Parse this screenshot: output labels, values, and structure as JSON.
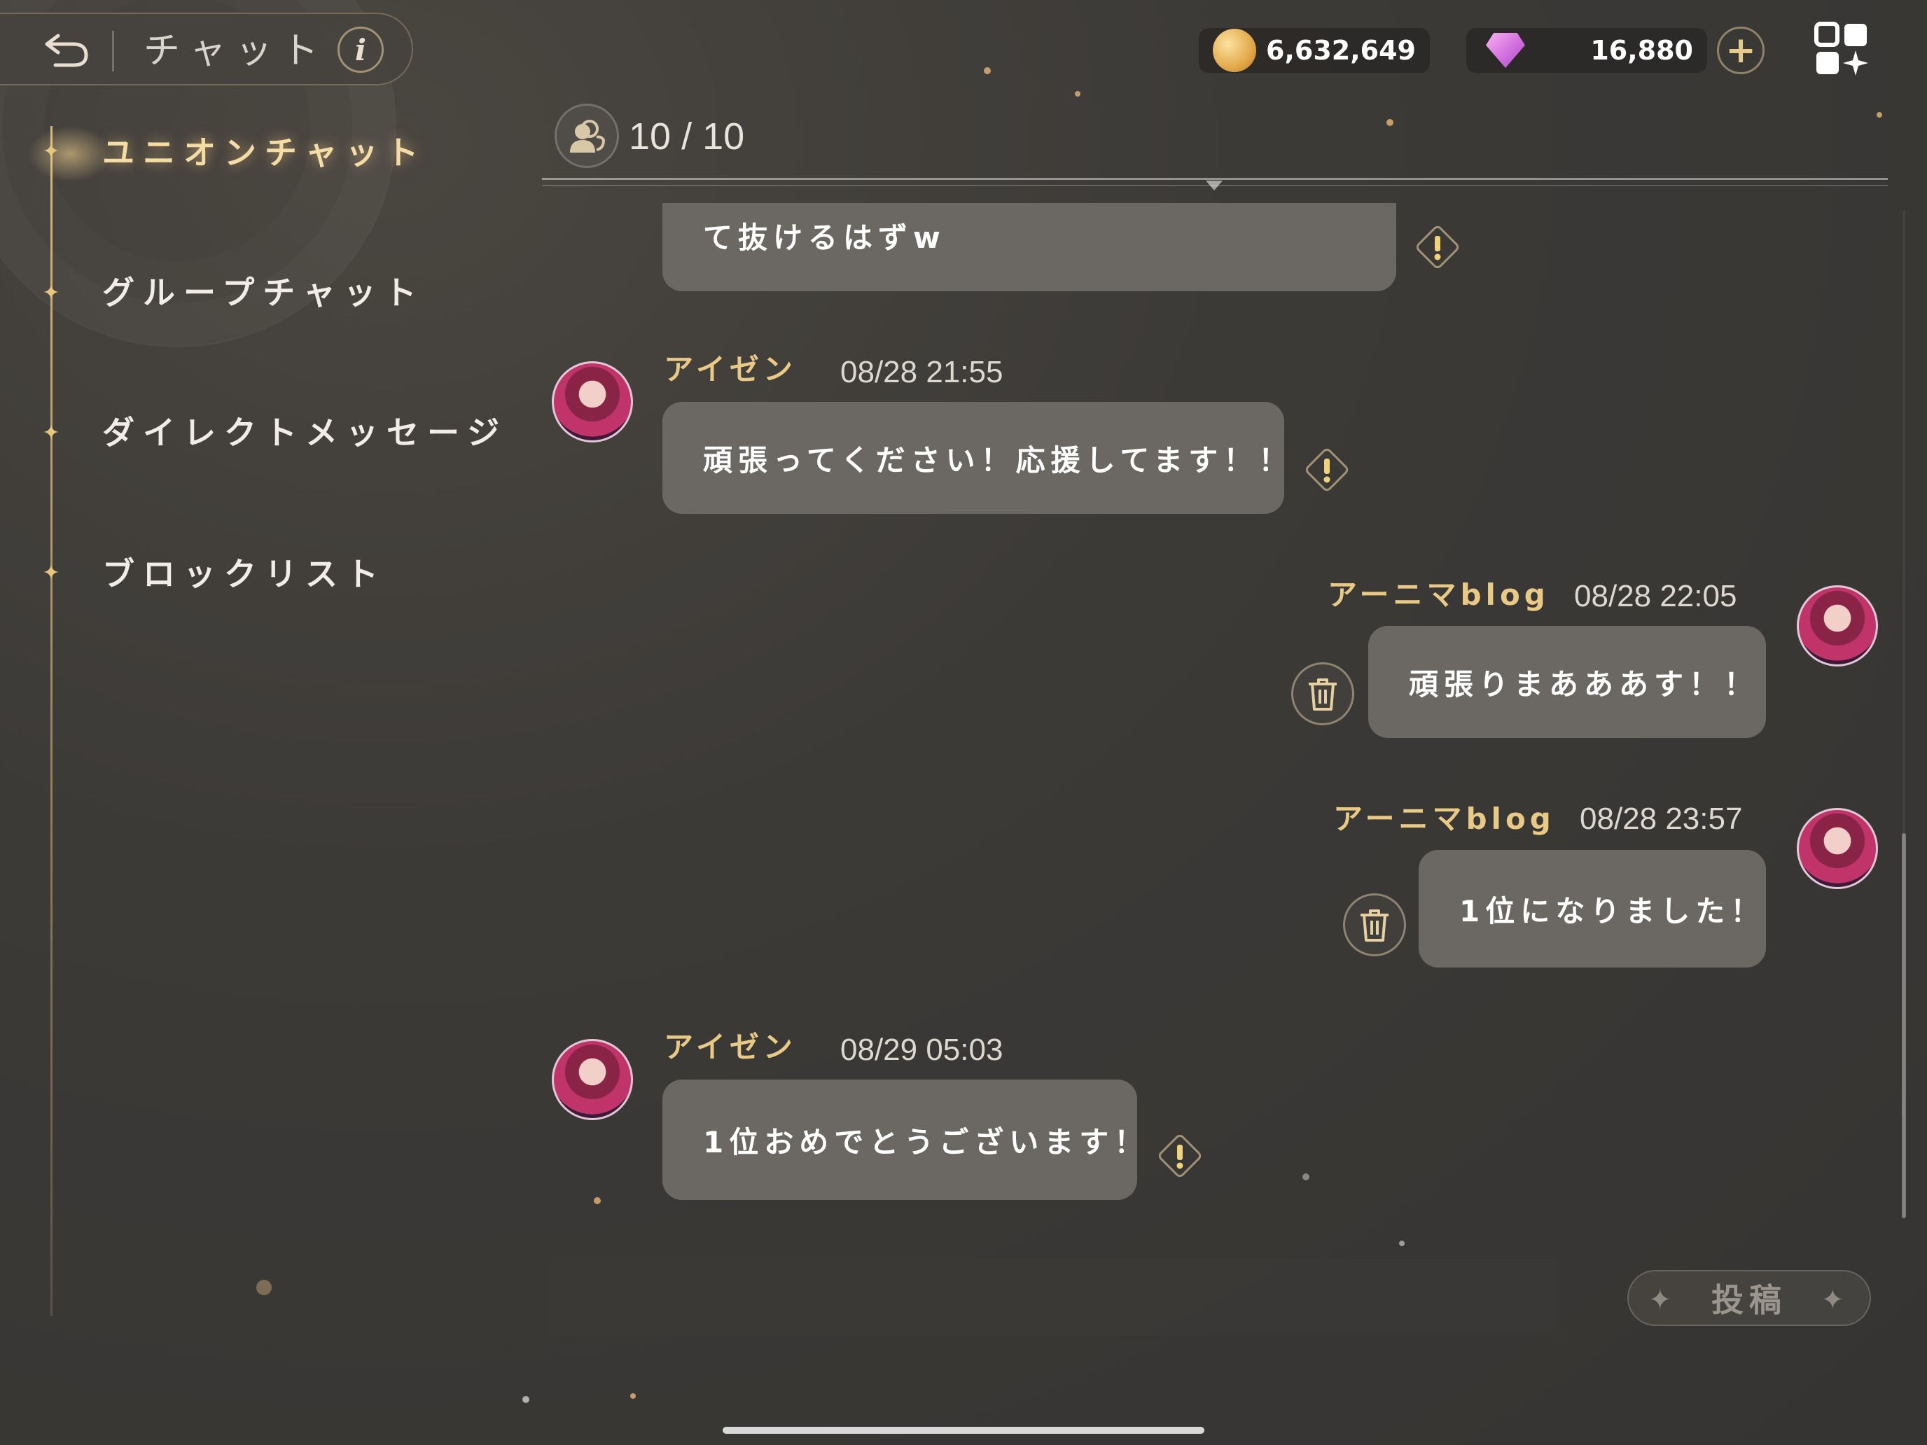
{
  "header": {
    "title": "チャット",
    "info_label": "i"
  },
  "currency": {
    "gold": "6,632,649",
    "gems": "16,880",
    "add_label": "+"
  },
  "sidebar": {
    "items": [
      {
        "label": "ユニオンチャット",
        "active": true
      },
      {
        "label": "グループチャット",
        "active": false
      },
      {
        "label": "ダイレクトメッセージ",
        "active": false
      },
      {
        "label": "ブロックリスト",
        "active": false
      }
    ]
  },
  "chat": {
    "member_count": "10 / 10",
    "partial_message": "て抜けるはずw",
    "messages": [
      {
        "name": "アイゼン",
        "time": "08/28 21:55",
        "text": "頑張ってください！応援してます！！",
        "side": "left"
      },
      {
        "name": "アーニマblog",
        "time": "08/28 22:05",
        "text": "頑張りまあああす！！",
        "side": "right"
      },
      {
        "name": "アーニマblog",
        "time": "08/28 23:57",
        "text": "1位になりました！",
        "side": "right"
      },
      {
        "name": "アイゼン",
        "time": "08/29 05:03",
        "text": "1位おめでとうございます！",
        "side": "left"
      }
    ]
  },
  "composer": {
    "placeholder": "",
    "post_label": "投稿"
  },
  "colors": {
    "accent_gold": "#e9c986",
    "bubble": "#6b6864",
    "background": "#3c3a37"
  }
}
